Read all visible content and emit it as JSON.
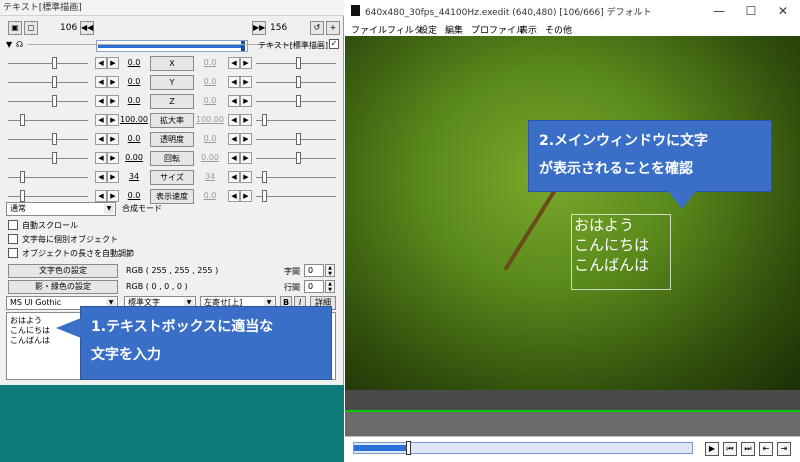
{
  "left_window": {
    "title": "テキスト[標準描画]",
    "frame_start": "106",
    "frame_end": "156",
    "seek_progress": 0.97,
    "subtitle": "テキスト[標準描画]",
    "params": [
      {
        "label": "X",
        "left": "0.0",
        "right": "0.0",
        "dim": false
      },
      {
        "label": "Y",
        "left": "0.0",
        "right": "0.0",
        "dim": false
      },
      {
        "label": "Z",
        "left": "0.0",
        "right": "0.0",
        "dim": false
      },
      {
        "label": "拡大率",
        "left": "100.00",
        "right": "100.00",
        "dim": true
      },
      {
        "label": "透明度",
        "left": "0.0",
        "right": "0.0",
        "dim": false
      },
      {
        "label": "回転",
        "left": "0.00",
        "right": "0.00",
        "dim": false
      },
      {
        "label": "サイズ",
        "left": "34",
        "right": "34",
        "dim": false
      },
      {
        "label": "表示速度",
        "left": "0.0",
        "right": "0.0",
        "dim": false
      }
    ],
    "blend_select": "通常",
    "blend_label": "合成モード",
    "checks": [
      {
        "label": "自動スクロール",
        "checked": false
      },
      {
        "label": "文字毎に個別オブジェクト",
        "checked": false
      },
      {
        "label": "オブジェクトの長さを自動調節",
        "checked": false
      }
    ],
    "text_color_button": "文字色の設定",
    "text_color_value": "RGB ( 255 , 255 , 255 )",
    "shadow_color_button": "影・縁色の設定",
    "shadow_color_value": "RGB ( 0 , 0 , 0 )",
    "char_spacing_label": "字間",
    "char_spacing_value": "0",
    "line_spacing_label": "行間",
    "line_spacing_value": "0",
    "font_select": "MS UI Gothic",
    "style_select": "標準文字",
    "align_select": "左寄せ[上]",
    "bold_btn": "B",
    "italic_btn": "I",
    "detail_btn": "詳細",
    "text_lines": [
      "おはよう",
      "こんにちは",
      "こんばんは"
    ]
  },
  "callouts": {
    "one_line1": "1.テキストボックスに適当な",
    "one_line2": "文字を入力",
    "two_line1": "2.メインウィンドウに文字",
    "two_line2": "が表示されることを確認"
  },
  "right_window": {
    "title": "640x480_30fps_44100Hz.exedit (640,480)  [106/666]  デフォルト",
    "menu": [
      "ファイル",
      "フィルタ",
      "設定",
      "編集",
      "プロファイル",
      "表示",
      "その他"
    ],
    "overlay_lines": [
      "おはよう",
      "こんにちは",
      "こんばんは"
    ],
    "playback_progress": 0.16
  }
}
